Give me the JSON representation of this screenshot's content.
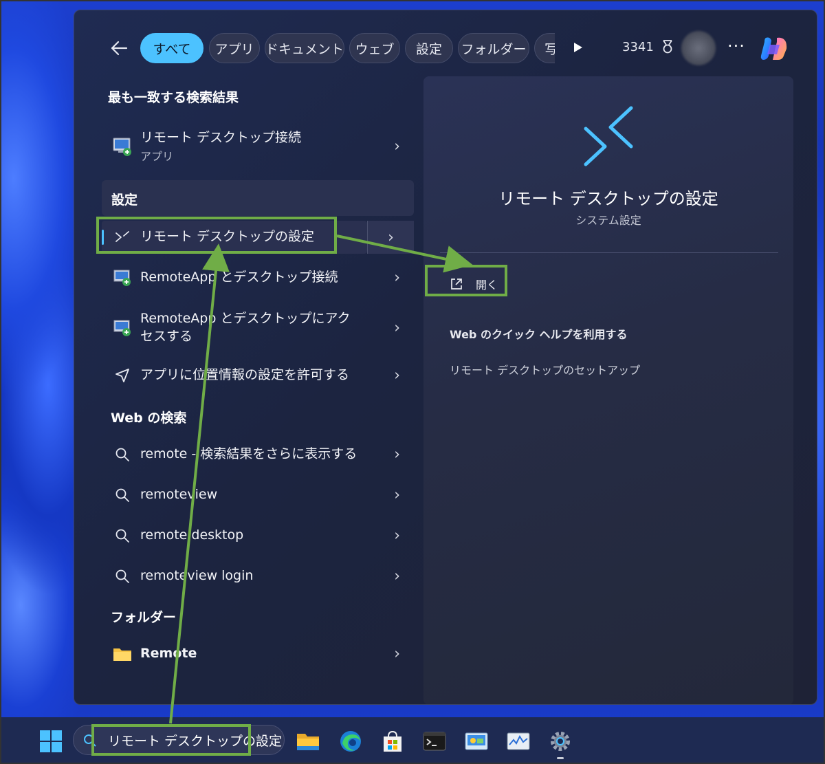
{
  "filters": {
    "back": "←",
    "chips": [
      "すべて",
      "アプリ",
      "ドキュメント",
      "ウェブ",
      "設定",
      "フォルダー",
      "写"
    ],
    "points": "3341",
    "more": "···"
  },
  "best_match": {
    "title": "最も一致する検索結果",
    "app_name": "リモート デスクトップ接続",
    "app_type": "アプリ"
  },
  "settings_section": {
    "title": "設定",
    "items": [
      "リモート デスクトップの設定",
      "RemoteApp とデスクトップ接続",
      "RemoteApp とデスクトップにアクセスする",
      "アプリに位置情報の設定を許可する"
    ]
  },
  "web_section": {
    "title": "Web の検索",
    "items": [
      "remote - 検索結果をさらに表示する",
      "remoteview",
      "remote desktop",
      "remoteview login"
    ]
  },
  "folder_section": {
    "title": "フォルダー",
    "items": [
      "Remote"
    ]
  },
  "detail": {
    "title": "リモート デスクトップの設定",
    "subtitle": "システム設定",
    "open": "開く",
    "web_help": "Web のクイック ヘルプを利用する",
    "setup": "リモート デスクトップのセットアップ"
  },
  "taskbar": {
    "search_text": "リモート デスクトップの設定"
  },
  "colors": {
    "accent": "#4cc2ff",
    "annotation": "#70ad47"
  },
  "icons": {
    "back": "arrow-left-icon",
    "remote_settings": "remote-desktop-settings-icon",
    "search": "search-icon",
    "folder": "folder-icon",
    "open": "external-link-icon"
  }
}
